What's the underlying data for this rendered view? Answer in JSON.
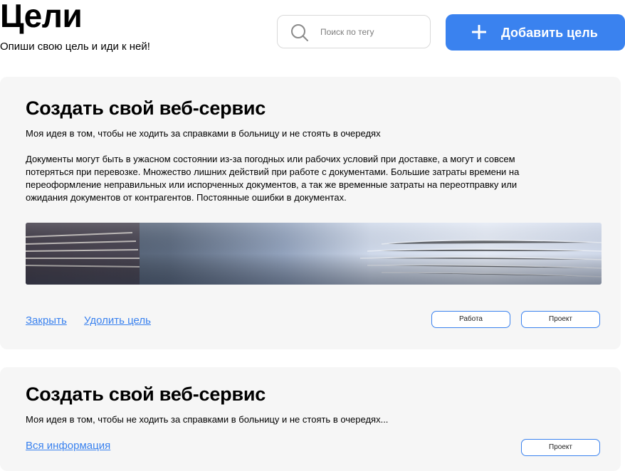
{
  "header": {
    "title": "Цели",
    "subtitle": "Опиши свою цель и иди к ней!",
    "search_placeholder": "Поиск по тегу",
    "add_button_label": "Добавить цель"
  },
  "goals": [
    {
      "title": "Создать свой веб-сервис",
      "summary": "Моя идея в том, чтобы не ходить за справками в больницу и не стоять в очередях",
      "description": "Документы могут быть в ужасном состоянии из-за погодных или рабочих условий при доставке, а могут и совсем потеряться при перевозке. Множество лишних действий при работе с документами. Большие затраты времени на переоформление неправильных или испорченных документов, а так же временные затраты на переотправку или ожидания документов от контрагентов. Постоянные ошибки в документах.",
      "close_label": "Закрыть",
      "delete_label": "Удолить цель",
      "tags": [
        "Работа",
        "Проект"
      ]
    },
    {
      "title": "Создать свой веб-сервис",
      "summary": "Моя идея в том, чтобы не ходить за справками в больницу и не стоять в очередях...",
      "more_label": "Вся информация",
      "tags": [
        "Проект"
      ]
    }
  ],
  "colors": {
    "accent": "#3a82ef",
    "card_bg": "#f6f6f6"
  }
}
